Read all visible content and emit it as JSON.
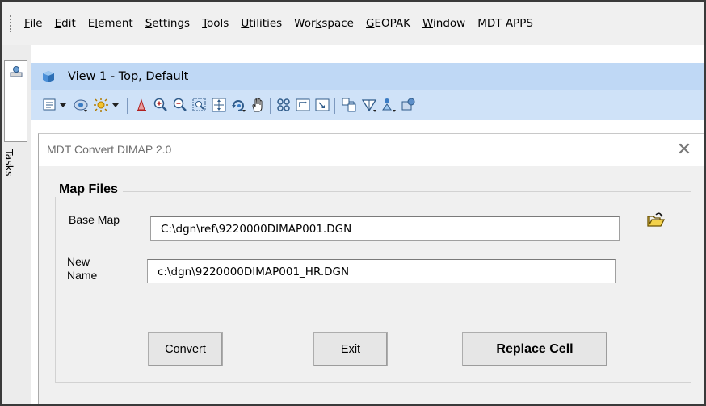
{
  "menu": {
    "items": [
      {
        "pre": "",
        "key": "F",
        "post": "ile"
      },
      {
        "pre": "",
        "key": "E",
        "post": "dit"
      },
      {
        "pre": "E",
        "key": "l",
        "post": "ement"
      },
      {
        "pre": "",
        "key": "S",
        "post": "ettings"
      },
      {
        "pre": "",
        "key": "T",
        "post": "ools"
      },
      {
        "pre": "",
        "key": "U",
        "post": "tilities"
      },
      {
        "pre": "Wor",
        "key": "k",
        "post": "space"
      },
      {
        "pre": "",
        "key": "G",
        "post": "EOPAK"
      },
      {
        "pre": "",
        "key": "W",
        "post": "indow"
      },
      {
        "pre": "MDT APPS",
        "key": "",
        "post": ""
      }
    ]
  },
  "tasks": {
    "label": "Tasks"
  },
  "view": {
    "title": "View 1 - Top, Default"
  },
  "toolbar": {
    "icons": [
      "element-selection-icon",
      "dropdown-arrow-icon",
      "view-attributes-icon",
      "lighting-icon",
      "dropdown-arrow-icon",
      "update-view-icon",
      "zoom-in-icon",
      "zoom-out-icon",
      "window-area-icon",
      "fit-view-icon",
      "rotate-view-icon",
      "pan-view-icon",
      "view-previous-icon",
      "view-next-icon",
      "clip-volume-icon",
      "clip-mask-icon",
      "change-view-perspective-icon",
      "view-display-mode-icon"
    ]
  },
  "dialog": {
    "title": "MDT Convert DIMAP 2.0",
    "close_label": "✕",
    "group_title": "Map Files",
    "base_map_label": "Base Map",
    "base_map_value": "C:\\dgn\\ref\\9220000DIMAP001.DGN",
    "new_name_label": "New\nName",
    "new_name_value": "c:\\dgn\\9220000DIMAP001_HR.DGN",
    "buttons": {
      "convert": "Convert",
      "exit": "Exit",
      "replace_cell": "Replace Cell"
    }
  },
  "colors": {
    "view_title_bg": "#bfd8f5",
    "view_toolbar_bg": "#cfe2f8",
    "dialog_bg": "#f0f0f0"
  }
}
